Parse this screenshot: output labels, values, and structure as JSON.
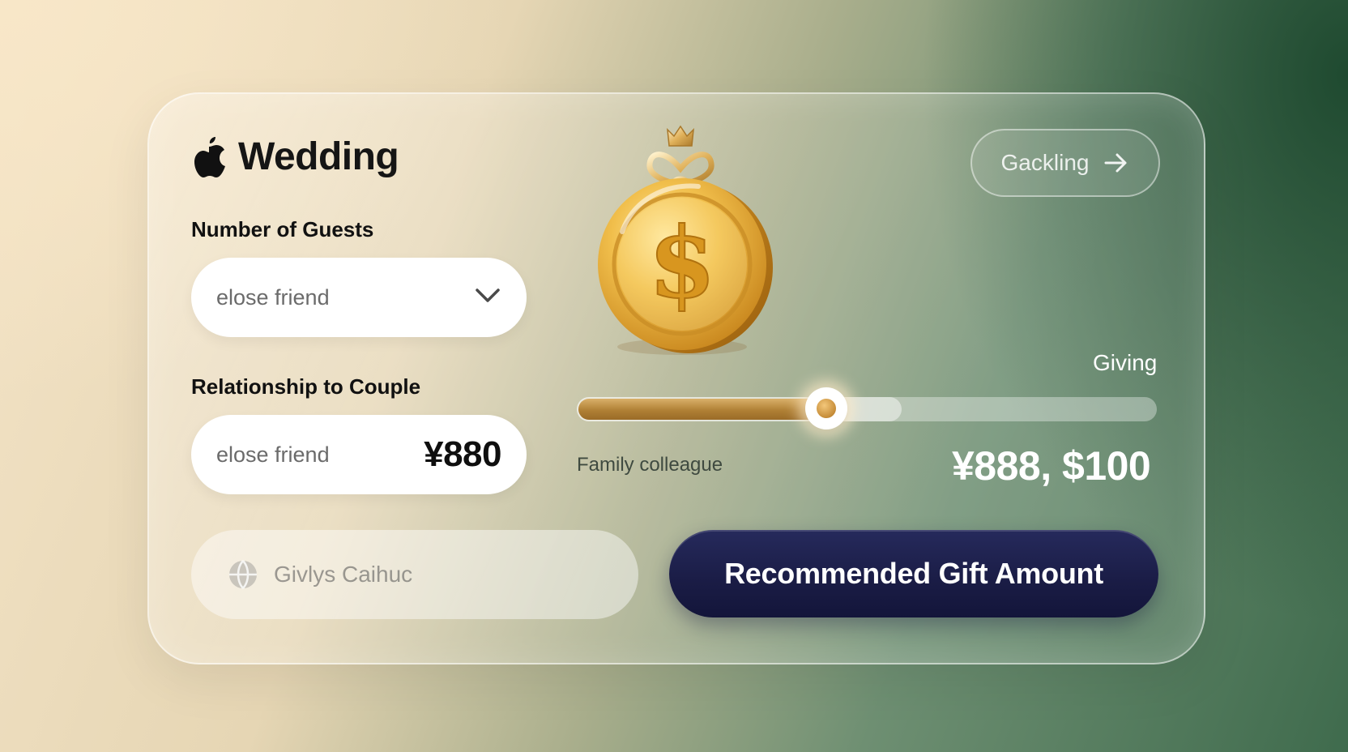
{
  "app": {
    "title": "Wedding",
    "brand_icon": "apple-logo-icon"
  },
  "form": {
    "guests_label": "Number of Guests",
    "guests_value": "elose friend",
    "relationship_label": "Relationship to Couple",
    "relationship_value": "elose friend",
    "relationship_amount": "¥880"
  },
  "header": {
    "back_button_label": "Gackling",
    "back_button_icon": "arrow-right-icon"
  },
  "slider": {
    "title": "Giving",
    "range_label": "Family colleague",
    "amount_display": "¥888, $100",
    "value_fraction": 0.43,
    "buffer_fraction": 0.56
  },
  "footer": {
    "secondary_text": "Givlys Caihuc",
    "secondary_icon": "globe-icon",
    "cta_label": "Recommended Gift Amount"
  },
  "illustration": {
    "icon": "gold-dollar-coin-icon"
  },
  "colors": {
    "cta": "#1a1c45",
    "slider_fill": "#b08035",
    "accent_green": "#3f6b4d",
    "accent_cream": "#f3e3c6"
  }
}
